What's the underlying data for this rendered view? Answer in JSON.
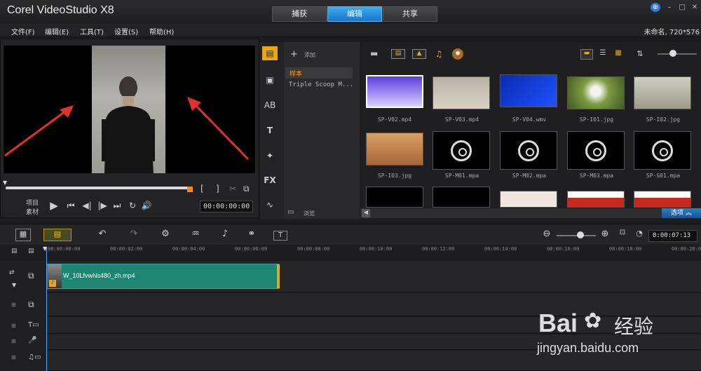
{
  "app": {
    "title": "Corel VideoStudio X8"
  },
  "mode_tabs": [
    {
      "label": "捕获"
    },
    {
      "label": "编辑"
    },
    {
      "label": "共享"
    }
  ],
  "menu": [
    {
      "label": "文件(F)"
    },
    {
      "label": "编辑(E)"
    },
    {
      "label": "工具(T)"
    },
    {
      "label": "设置(S)"
    },
    {
      "label": "帮助(H)"
    }
  ],
  "project_info": "未命名, 720*576",
  "player": {
    "mode_labels": {
      "project": "项目",
      "clip": "素材"
    },
    "timecode": "00:00:00:00"
  },
  "library": {
    "add_label": "添加",
    "folders": [
      {
        "label": "样本"
      },
      {
        "label": "Triple Scoop M..."
      }
    ],
    "browse_label": "浏览",
    "options_label": "选项",
    "items": [
      {
        "label": "SP-V02.mp4",
        "kind": "video"
      },
      {
        "label": "SP-V03.mp4",
        "kind": "video"
      },
      {
        "label": "SP-V04.wmv",
        "kind": "video"
      },
      {
        "label": "SP-I01.jpg",
        "kind": "image"
      },
      {
        "label": "SP-I02.jpg",
        "kind": "image"
      },
      {
        "label": "SP-I03.jpg",
        "kind": "image"
      },
      {
        "label": "SP-M01.mpa",
        "kind": "music"
      },
      {
        "label": "SP-M02.mpa",
        "kind": "music"
      },
      {
        "label": "SP-M03.mpa",
        "kind": "music"
      },
      {
        "label": "SP-S01.mpa",
        "kind": "music"
      }
    ]
  },
  "timeline": {
    "timecode": "0:00:07:13",
    "ruler_ticks": [
      "00:00:00:00",
      "00:00:02:00",
      "00:00:04:00",
      "00:00:06:00",
      "00:00:08:00",
      "00:00:10:00",
      "00:00:12:00",
      "00:00:14:00",
      "00:00:16:00",
      "00:00:18:00",
      "00:00:20:00"
    ],
    "clip_label": "W_10LfvwNs480_zh.mp4"
  },
  "watermark": {
    "brand": "Bai",
    "brand2": "经验",
    "url": "jingyan.baidu.com"
  },
  "colors": {
    "accent": "#1c86d8",
    "clip": "#1e8670",
    "arrow": "#e03030"
  }
}
